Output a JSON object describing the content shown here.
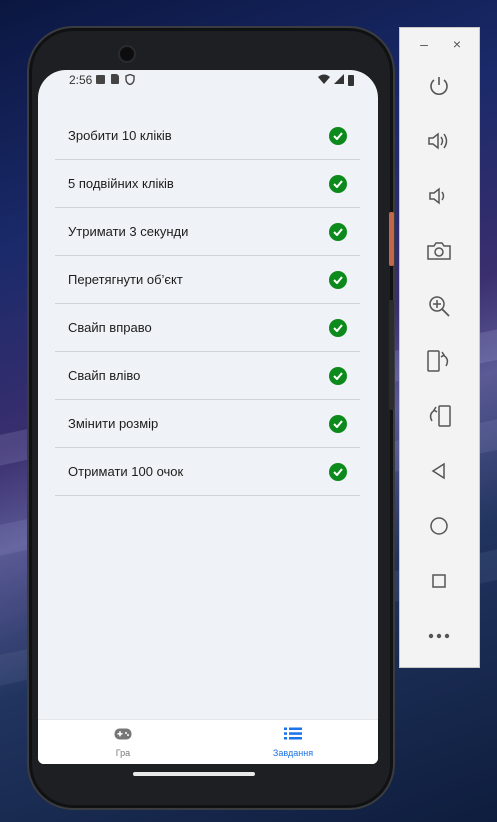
{
  "status_bar": {
    "time": "2:56"
  },
  "tasks": [
    {
      "label": "Зробити 10 кліків",
      "done": true
    },
    {
      "label": "5 подвійних кліків",
      "done": true
    },
    {
      "label": "Утримати 3 секунди",
      "done": true
    },
    {
      "label": "Перетягнути об’єкт",
      "done": true
    },
    {
      "label": "Свайп вправо",
      "done": true
    },
    {
      "label": "Свайп вліво",
      "done": true
    },
    {
      "label": "Змінити розмір",
      "done": true
    },
    {
      "label": "Отримати 100 очок",
      "done": true
    }
  ],
  "bottom_nav": {
    "items": [
      {
        "label": "Гра",
        "icon": "gamepad-icon",
        "active": false
      },
      {
        "label": "Завдання",
        "icon": "list-icon",
        "active": true
      }
    ]
  },
  "emulator_panel": {
    "buttons": [
      "minimize-icon",
      "close-icon",
      "power-icon",
      "volume-up-icon",
      "volume-down-icon",
      "camera-icon",
      "zoom-icon",
      "rotate-left-icon",
      "rotate-right-icon",
      "back-icon",
      "home-icon",
      "overview-icon",
      "more-icon"
    ]
  },
  "colors": {
    "check": "#0c8a1c",
    "accent": "#1a73e8",
    "inactive": "#777777",
    "screen_bg": "#eff2f6"
  }
}
